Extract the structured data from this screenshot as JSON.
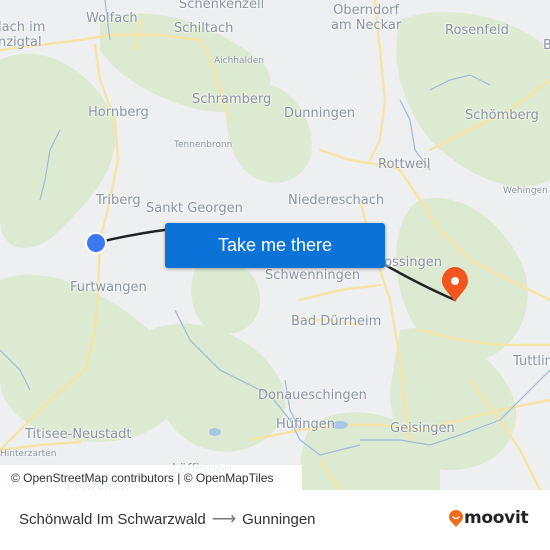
{
  "map": {
    "places": [
      {
        "name": "Wolfach",
        "size": "normal"
      },
      {
        "name": "Schenkenzell",
        "size": "normal"
      },
      {
        "name": "Schiltach",
        "size": "normal"
      },
      {
        "name": "Oberndorf\nam Neckar",
        "size": "normal"
      },
      {
        "name": "Rosenfeld",
        "size": "normal"
      },
      {
        "name": "lach im\nnzigtal",
        "size": "normal"
      },
      {
        "name": "Aichhalden",
        "size": "small"
      },
      {
        "name": "Hornberg",
        "size": "normal"
      },
      {
        "name": "Schramberg",
        "size": "normal"
      },
      {
        "name": "Dunningen",
        "size": "normal"
      },
      {
        "name": "Schömberg",
        "size": "normal"
      },
      {
        "name": "Tennenbronn",
        "size": "small"
      },
      {
        "name": "Rottweil",
        "size": "normal"
      },
      {
        "name": "Wehingen",
        "size": "small"
      },
      {
        "name": "Triberg",
        "size": "normal"
      },
      {
        "name": "Sankt Georgen",
        "size": "normal"
      },
      {
        "name": "Niedereschach",
        "size": "normal"
      },
      {
        "name": "Furtwangen",
        "size": "normal"
      },
      {
        "name": "Schwenningen",
        "size": "normal"
      },
      {
        "name": "Trossingen",
        "size": "normal"
      },
      {
        "name": "Bad Dürrheim",
        "size": "normal"
      },
      {
        "name": "Tuttlingen",
        "size": "normal"
      },
      {
        "name": "Donaueschingen",
        "size": "normal"
      },
      {
        "name": "Hüfingen",
        "size": "normal"
      },
      {
        "name": "Geisingen",
        "size": "normal"
      },
      {
        "name": "Titisee-Neustadt",
        "size": "normal"
      },
      {
        "name": "Hinterzarten",
        "size": "small"
      },
      {
        "name": "Löffingen",
        "size": "normal"
      },
      {
        "name": "Lenzkirch",
        "size": "normal"
      },
      {
        "name": "B",
        "size": "normal"
      }
    ],
    "origin_marker": {
      "color": "#3a78f0",
      "label": "origin"
    },
    "destination_marker": {
      "color": "#f2561d",
      "label": "destination"
    },
    "route_line_color": "#222222"
  },
  "cta": {
    "label": "Take me there",
    "color": "#0b73d8"
  },
  "attribution": "© OpenStreetMap contributors | © OpenMapTiles",
  "footer": {
    "origin": "Schönwald Im Schwarzwald",
    "arrow": "⟶",
    "destination": "Gunningen",
    "brand": "moovit",
    "brand_color": "#f26a1b"
  }
}
